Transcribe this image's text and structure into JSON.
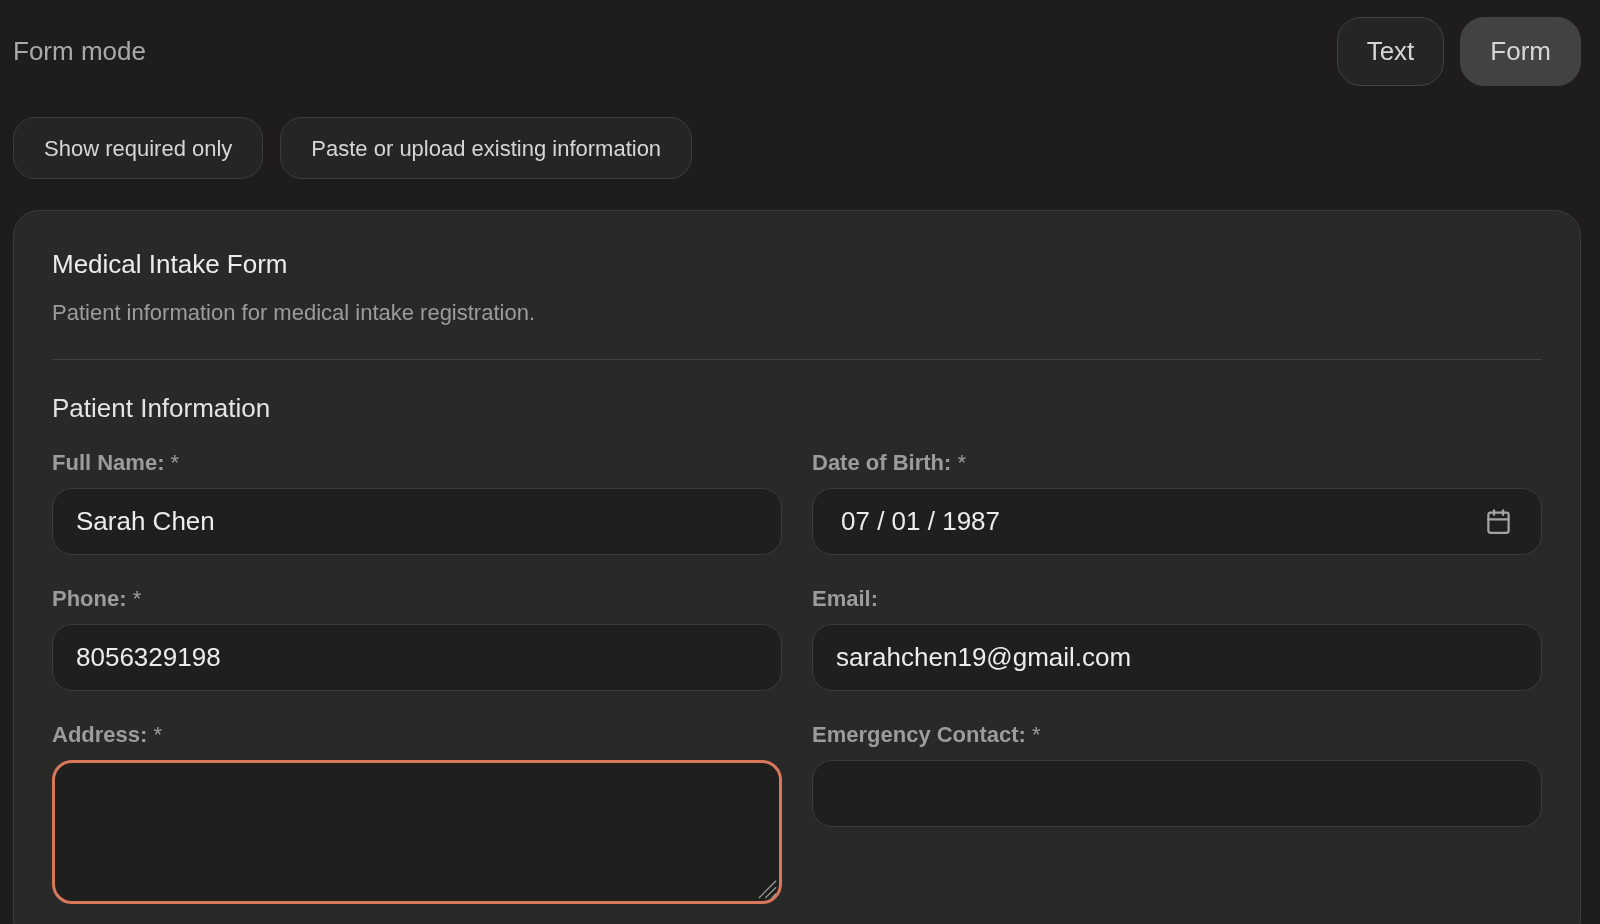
{
  "header": {
    "title": "Form mode",
    "mode_tabs": [
      {
        "label": "Text",
        "selected": false
      },
      {
        "label": "Form",
        "selected": true
      }
    ]
  },
  "actions": [
    "Show required only",
    "Paste or upload existing information"
  ],
  "form": {
    "title": "Medical Intake Form",
    "description": "Patient information for medical intake registration.",
    "sections": [
      {
        "title": "Patient Information",
        "fields": [
          {
            "kind": "text",
            "label": "Full Name:",
            "required_mark": "*",
            "value": "Sarah Chen",
            "focused": false
          },
          {
            "kind": "date",
            "label": "Date of Birth:",
            "required_mark": "*",
            "value": "07 / 01 / 1987",
            "focused": false
          },
          {
            "kind": "text",
            "label": "Phone:",
            "required_mark": "*",
            "value": "8056329198",
            "focused": false
          },
          {
            "kind": "text",
            "label": "Email:",
            "value": "sarahchen19@gmail.com",
            "focused": false
          },
          {
            "kind": "textarea",
            "label": "Address:",
            "required_mark": "*",
            "focused": true
          },
          {
            "kind": "text",
            "label": "Emergency Contact:",
            "required_mark": "*",
            "focused": false
          }
        ]
      }
    ]
  }
}
